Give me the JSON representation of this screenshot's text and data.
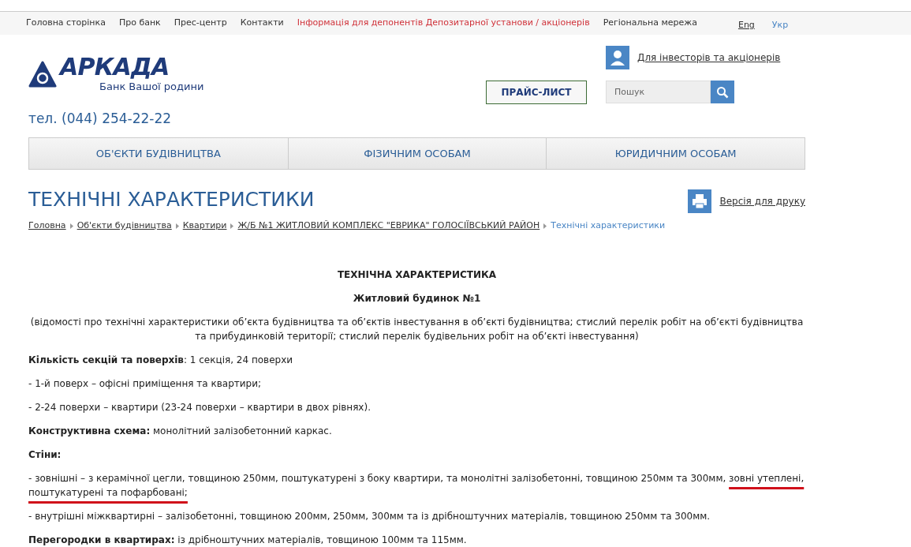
{
  "top_menu": [
    {
      "label": "Головна сторінка",
      "kind": "normal"
    },
    {
      "label": "Про банк",
      "kind": "normal"
    },
    {
      "label": "Прес-центр",
      "kind": "normal"
    },
    {
      "label": "Контакти",
      "kind": "normal"
    },
    {
      "label": "Інформація для депонентів Депозитарної установи / акціонерів",
      "kind": "alert"
    },
    {
      "label": "Регіональна мережа",
      "kind": "normal"
    }
  ],
  "languages": [
    {
      "label": "Eng",
      "selected": false
    },
    {
      "label": "Укр",
      "selected": true
    }
  ],
  "logo": {
    "name": "АРКАДА",
    "tagline": "Банк Вашої родини"
  },
  "phone": "тел. (044) 254-22-22",
  "price_button": "ПРАЙС-ЛИСТ",
  "investors_link": "Для інвесторів та акціонерів",
  "search": {
    "placeholder": "Пошук"
  },
  "main_nav": [
    "ОБ'ЄКТИ БУДІВНИЦТВА",
    "ФІЗИЧНИМ ОСОБАМ",
    "ЮРИДИЧНИМ ОСОБАМ"
  ],
  "page_title": "ТЕХНІЧНІ ХАРАКТЕРИСТИКИ",
  "print_link": "Версія для друку",
  "breadcrumbs": [
    {
      "label": "Головна",
      "current": false
    },
    {
      "label": "Об'єкти будівництва",
      "current": false
    },
    {
      "label": "Квартири",
      "current": false
    },
    {
      "label": "Ж/Б №1 ЖИТЛОВИЙ КОМПЛЕКС \"ЕВРИКА\" ГОЛОСІЇВСЬКИЙ РАЙОН",
      "current": false
    },
    {
      "label": "Технічні характеристики",
      "current": true
    }
  ],
  "content": [
    {
      "kind": "heading",
      "text": "ТЕХНІЧНА ХАРАКТЕРИСТИКА"
    },
    {
      "kind": "heading",
      "text": "Житловий будинок №1"
    },
    {
      "kind": "note",
      "text": "(відомості про технічні характеристики об’єкта будівництва та об’єктів інвестування в об’єкті будівництва; стислий перелік робіт на об’єкті будівництва та прибудинковій території; стислий перелік будівельних робіт на об’єкті інвестування)"
    },
    {
      "kind": "text",
      "text": "**Кількість секцій та поверхів**: 1 секція, 24 поверхи"
    },
    {
      "kind": "text",
      "text": "- 1-й поверх – офісні приміщення та квартири;"
    },
    {
      "kind": "text",
      "text": "- 2-24 поверхи – квартири (23-24 поверхи – квартири в двох рівнях)."
    },
    {
      "kind": "text",
      "text": "**Конструктивна схема:** монолітний залізобетонний каркас."
    },
    {
      "kind": "text",
      "text": "**Стіни:**"
    },
    {
      "kind": "text",
      "text": "- зовнішні – з керамічної цегли, товщиною 250мм, поштукатурені з боку квартири, та  монолітні залізобетонні, товщиною 250мм та 300мм, ",
      "highlight": "зовні утеплені, поштукатурені та пофарбовані;"
    },
    {
      "kind": "text",
      "text": "- внутрішні міжквартирні – залізобетонні, товщиною 200мм, 250мм, 300мм та із дрібноштучних матеріалів, товщиною 250мм та 300мм."
    },
    {
      "kind": "text",
      "text": "**Перегородки в квартирах:** із дрібноштучних матеріалів, товщиною 100мм та 115мм."
    }
  ]
}
